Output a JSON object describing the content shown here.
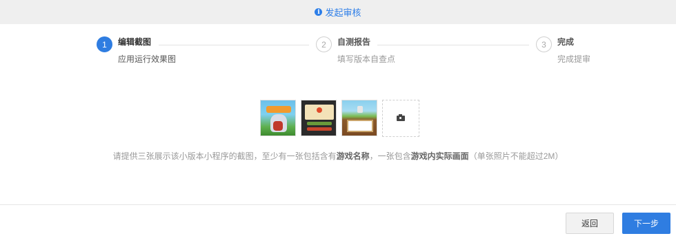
{
  "header": {
    "info_icon": "info-icon",
    "title": "发起审核"
  },
  "steps": [
    {
      "number": "1",
      "title": "编辑截图",
      "desc": "应用运行效果图",
      "active": true
    },
    {
      "number": "2",
      "title": "自测报告",
      "desc": "填写版本自查点",
      "active": false
    },
    {
      "number": "3",
      "title": "完成",
      "desc": "完成提审",
      "active": false
    }
  ],
  "uploader": {
    "camera_icon": "camera-icon"
  },
  "hint": {
    "part1": "请提供三张展示该小版本小程序的截图，至少有一张包括含有",
    "bold1": "游戏名称",
    "part2": "，一张包含",
    "bold2": "游戏内实际画面",
    "part3": "（单张照片不能超过2M）"
  },
  "footer": {
    "back_label": "返回",
    "next_label": "下一步"
  },
  "colors": {
    "accent": "#2f7de1",
    "topbar_bg": "#efefef"
  }
}
